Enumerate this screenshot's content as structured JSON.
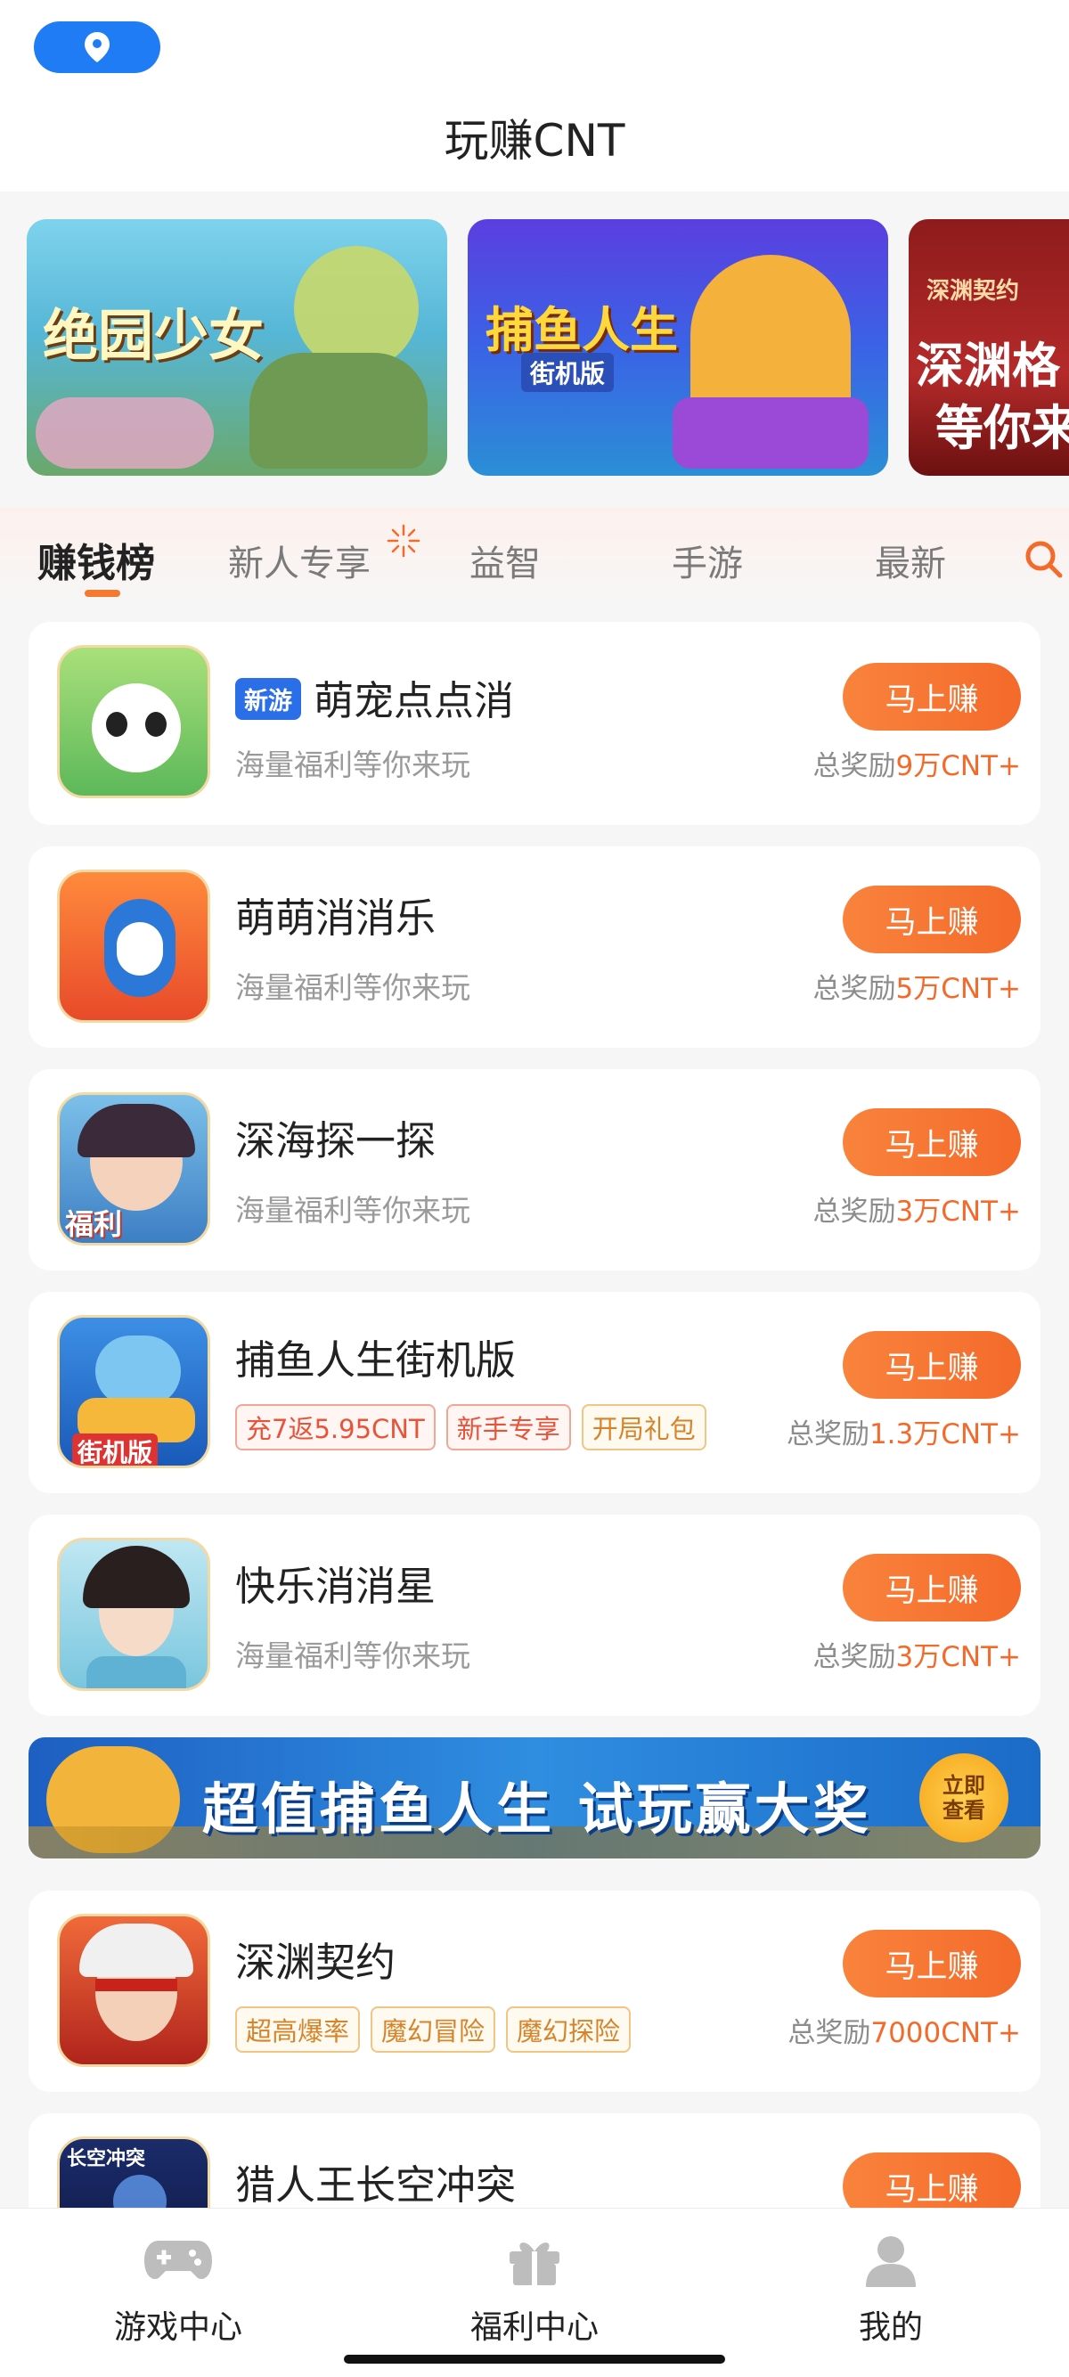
{
  "header": {
    "title": "玩赚CNT",
    "location_icon": "location-pin-icon"
  },
  "banners": [
    {
      "text": "绝园少女"
    },
    {
      "text": "捕鱼人生",
      "subtext": "街机版"
    },
    {
      "text": "深渊格",
      "subtext": "等你来",
      "top_text": "深渊契约"
    }
  ],
  "tabs": [
    {
      "label": "赚钱榜",
      "active": true
    },
    {
      "label": "新人专享"
    },
    {
      "label": "益智"
    },
    {
      "label": "手游"
    },
    {
      "label": "最新"
    }
  ],
  "games": [
    {
      "name": "萌宠点点消",
      "badge": "新游",
      "subtitle": "海量福利等你来玩",
      "button": "马上赚",
      "reward_prefix": "总奖励",
      "reward_amount": "9万CNT+"
    },
    {
      "name": "萌萌消消乐",
      "subtitle": "海量福利等你来玩",
      "button": "马上赚",
      "reward_prefix": "总奖励",
      "reward_amount": "5万CNT+"
    },
    {
      "name": "深海探一探",
      "subtitle": "海量福利等你来玩",
      "button": "马上赚",
      "reward_prefix": "总奖励",
      "reward_amount": "3万CNT+",
      "icon_label": "福利"
    },
    {
      "name": "捕鱼人生街机版",
      "tags": [
        "充7返5.95CNT",
        "新手专享",
        "开局礼包"
      ],
      "button": "马上赚",
      "reward_prefix": "总奖励",
      "reward_amount": "1.3万CNT+",
      "icon_label": "街机版"
    },
    {
      "name": "快乐消消星",
      "subtitle": "海量福利等你来玩",
      "button": "马上赚",
      "reward_prefix": "总奖励",
      "reward_amount": "3万CNT+"
    },
    {
      "name": "深渊契约",
      "tags": [
        "超高爆率",
        "魔幻冒险",
        "魔幻探险"
      ],
      "button": "马上赚",
      "reward_prefix": "总奖励",
      "reward_amount": "7000CNT+"
    },
    {
      "name": "猎人王长空冲突",
      "button": "马上赚",
      "icon_label": "长空冲突"
    }
  ],
  "promo": {
    "text": "超值捕鱼人生 试玩赢大奖",
    "button_line1": "立即",
    "button_line2": "查看"
  },
  "bottom_nav": [
    {
      "label": "游戏中心",
      "icon": "gamepad-icon"
    },
    {
      "label": "福利中心",
      "icon": "gift-icon"
    },
    {
      "label": "我的",
      "icon": "user-icon"
    }
  ],
  "colors": {
    "accent": "#f46a2a",
    "location_blue": "#1f7cf5",
    "new_badge": "#2a6ee8"
  }
}
